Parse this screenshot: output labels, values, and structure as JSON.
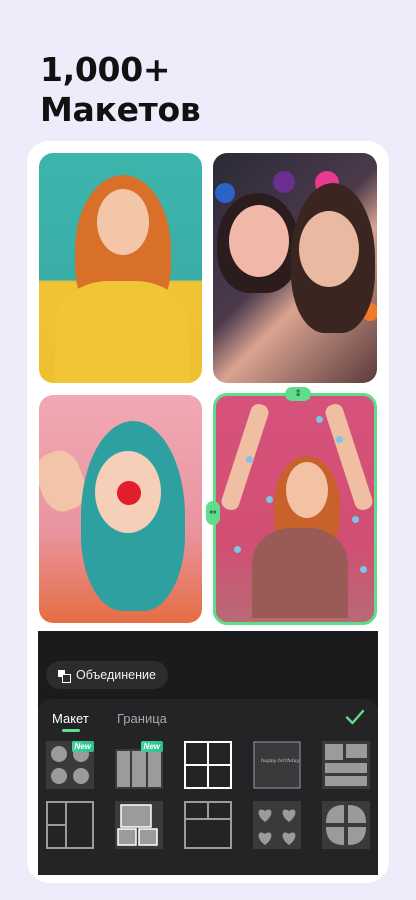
{
  "headline": {
    "line1": "1,000+",
    "line2": "Макетов"
  },
  "toolbar": {
    "merge_label": "Объединение"
  },
  "tabs": [
    {
      "label": "Макет",
      "selected": true
    },
    {
      "label": "Граница",
      "selected": false
    }
  ],
  "layouts": {
    "new_badge": "New",
    "decor_text": "happy birthday",
    "items": [
      {
        "name": "flower-quad",
        "badge": true
      },
      {
        "name": "film-strip",
        "badge": true
      },
      {
        "name": "grid-2x2",
        "badge": false
      },
      {
        "name": "birthday-frame",
        "badge": false
      },
      {
        "name": "torn-paper",
        "badge": false
      },
      {
        "name": "side-split",
        "badge": false
      },
      {
        "name": "polaroid",
        "badge": false
      },
      {
        "name": "top-split",
        "badge": false
      },
      {
        "name": "hearts",
        "badge": false
      },
      {
        "name": "petals",
        "badge": false
      }
    ]
  },
  "colors": {
    "accent": "#5fdd8b",
    "background": "#efebfa",
    "panel": "#1b1b1d"
  },
  "icons": [
    "merge-icon",
    "checkmark-icon",
    "resize-vertical-icon",
    "resize-horizontal-icon"
  ]
}
